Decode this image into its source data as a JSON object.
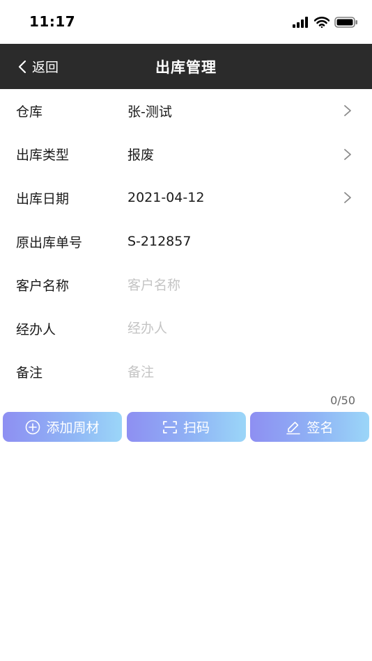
{
  "status_bar": {
    "time": "11:17"
  },
  "header": {
    "back_label": "返回",
    "title": "出库管理"
  },
  "form": {
    "warehouse": {
      "label": "仓库",
      "value": "张-测试"
    },
    "outbound_type": {
      "label": "出库类型",
      "value": "报废"
    },
    "outbound_date": {
      "label": "出库日期",
      "value": "2021-04-12"
    },
    "original_order_no": {
      "label": "原出库单号",
      "value": "S-212857"
    },
    "customer_name": {
      "label": "客户名称",
      "placeholder": "客户名称",
      "value": ""
    },
    "handler": {
      "label": "经办人",
      "placeholder": "经办人",
      "value": ""
    },
    "remark": {
      "label": "备注",
      "placeholder": "备注",
      "value": ""
    },
    "remark_counter": "0/50"
  },
  "actions": {
    "add_material": "添加周材",
    "scan": "扫码",
    "sign": "签名"
  },
  "colors": {
    "navbar_bg": "#2b2b2b",
    "button_gradient_start": "#8e8ff2",
    "button_gradient_end": "#9bd6f8",
    "placeholder": "#c4c4c4"
  },
  "icons": {
    "back": "chevron-left-icon",
    "row_arrow": "chevron-right-icon",
    "add": "plus-circle-icon",
    "scan": "scan-icon",
    "sign": "pencil-icon"
  }
}
